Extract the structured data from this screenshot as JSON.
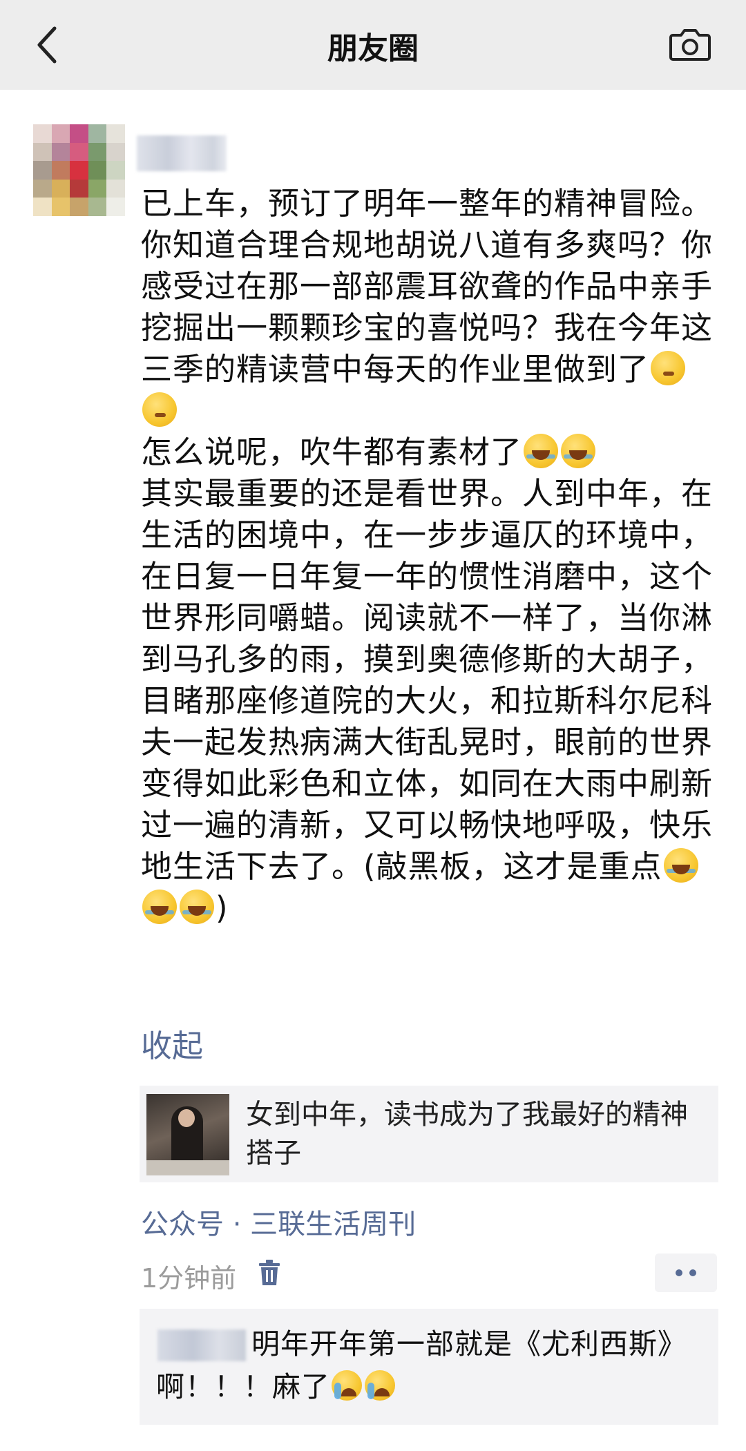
{
  "header": {
    "title": "朋友圈",
    "back_icon": "chevron-left-icon",
    "camera_icon": "camera-icon"
  },
  "post": {
    "paragraphs": [
      "已上车，预订了明年一整年的精神冒险。",
      "你知道合理合规地胡说八道有多爽吗？你感受过在那一部部震耳欲聋的作品中亲手挖掘出一颗颗珍宝的喜悦吗？我在今年这三季的精读营中每天的作业里做到了",
      "怎么说呢，吹牛都有素材了",
      "其实最重要的还是看世界。人到中年，在生活的困境中，在一步步逼仄的环境中，在日复一日年复一年的惯性消磨中，这个世界形同嚼蜡。阅读就不一样了，当你淋到马孔多的雨，摸到奥德修斯的大胡子，目睹那座修道院的大火，和拉斯科尔尼科夫一起发热病满大街乱晃时，眼前的世界变得如此彩色和立体，如同在大雨中刷新过一遍的清新，又可以畅快地呼吸，快乐地生活下去了。(敲黑板，这才是重点",
      ")"
    ],
    "collapse_label": "收起",
    "share_card": {
      "title": "女到中年，读书成为了我最好的精神搭子"
    },
    "source": "公众号 · 三联生活周刊",
    "time": "1分钟前",
    "delete_icon": "trash-icon",
    "more_icon": "more-dots-icon"
  },
  "comment": {
    "text": "明年开年第一部就是《尤利西斯》啊！！！麻了"
  },
  "colors": {
    "link": "#576b95",
    "header_bg": "#ededed",
    "card_bg": "#f3f3f5",
    "muted": "#9b9b9b"
  }
}
